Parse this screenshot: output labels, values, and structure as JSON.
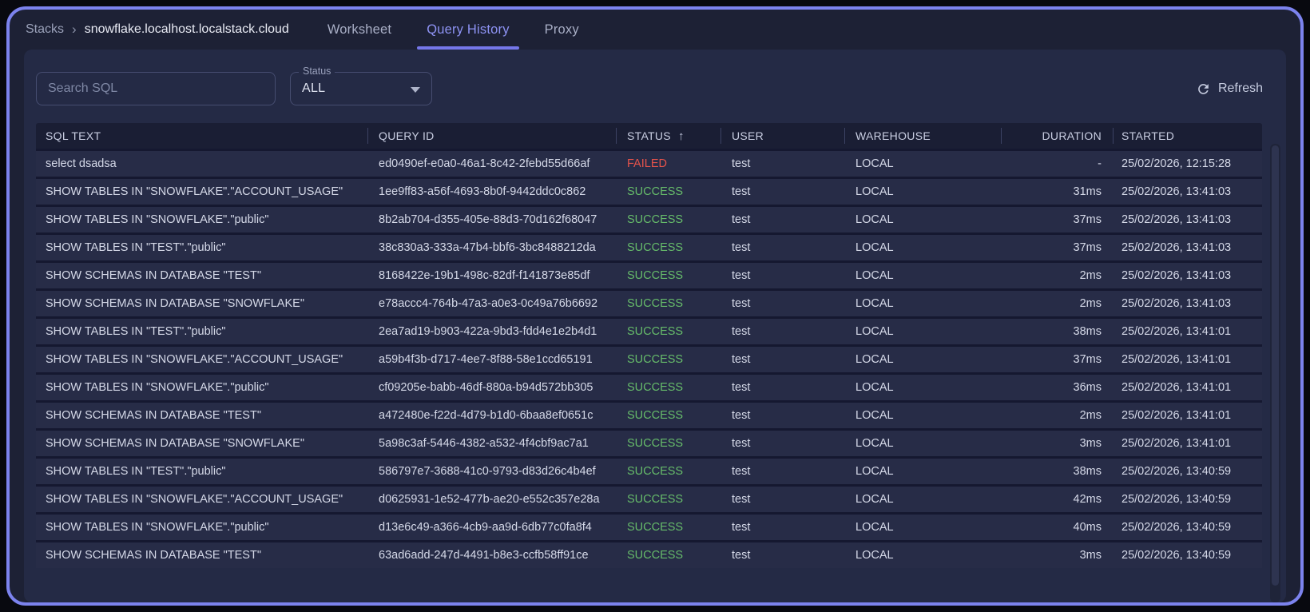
{
  "breadcrumb": {
    "root": "Stacks",
    "separator": "›",
    "current": "snowflake.localhost.localstack.cloud"
  },
  "tabs": [
    {
      "label": "Worksheet",
      "active": false
    },
    {
      "label": "Query History",
      "active": true
    },
    {
      "label": "Proxy",
      "active": false
    }
  ],
  "controls": {
    "search_placeholder": "Search SQL",
    "search_value": "",
    "status_filter": {
      "label": "Status",
      "value": "ALL"
    },
    "refresh_label": "Refresh"
  },
  "table": {
    "columns": [
      "SQL TEXT",
      "QUERY ID",
      "STATUS",
      "USER",
      "WAREHOUSE",
      "DURATION",
      "STARTED"
    ],
    "sorted_column": "STATUS",
    "sort_direction": "asc",
    "sort_arrow": "↑",
    "rows": [
      {
        "sql": "select dsadsa",
        "query_id": "ed0490ef-e0a0-46a1-8c42-2febd55d66af",
        "status": "FAILED",
        "user": "test",
        "warehouse": "LOCAL",
        "duration": "-",
        "started": "25/02/2026, 12:15:28"
      },
      {
        "sql": "SHOW TABLES IN \"SNOWFLAKE\".\"ACCOUNT_USAGE\"",
        "query_id": "1ee9ff83-a56f-4693-8b0f-9442ddc0c862",
        "status": "SUCCESS",
        "user": "test",
        "warehouse": "LOCAL",
        "duration": "31ms",
        "started": "25/02/2026, 13:41:03"
      },
      {
        "sql": "SHOW TABLES IN \"SNOWFLAKE\".\"public\"",
        "query_id": "8b2ab704-d355-405e-88d3-70d162f68047",
        "status": "SUCCESS",
        "user": "test",
        "warehouse": "LOCAL",
        "duration": "37ms",
        "started": "25/02/2026, 13:41:03"
      },
      {
        "sql": "SHOW TABLES IN \"TEST\".\"public\"",
        "query_id": "38c830a3-333a-47b4-bbf6-3bc8488212da",
        "status": "SUCCESS",
        "user": "test",
        "warehouse": "LOCAL",
        "duration": "37ms",
        "started": "25/02/2026, 13:41:03"
      },
      {
        "sql": "SHOW SCHEMAS IN DATABASE \"TEST\"",
        "query_id": "8168422e-19b1-498c-82df-f141873e85df",
        "status": "SUCCESS",
        "user": "test",
        "warehouse": "LOCAL",
        "duration": "2ms",
        "started": "25/02/2026, 13:41:03"
      },
      {
        "sql": "SHOW SCHEMAS IN DATABASE \"SNOWFLAKE\"",
        "query_id": "e78accc4-764b-47a3-a0e3-0c49a76b6692",
        "status": "SUCCESS",
        "user": "test",
        "warehouse": "LOCAL",
        "duration": "2ms",
        "started": "25/02/2026, 13:41:03"
      },
      {
        "sql": "SHOW TABLES IN \"TEST\".\"public\"",
        "query_id": "2ea7ad19-b903-422a-9bd3-fdd4e1e2b4d1",
        "status": "SUCCESS",
        "user": "test",
        "warehouse": "LOCAL",
        "duration": "38ms",
        "started": "25/02/2026, 13:41:01"
      },
      {
        "sql": "SHOW TABLES IN \"SNOWFLAKE\".\"ACCOUNT_USAGE\"",
        "query_id": "a59b4f3b-d717-4ee7-8f88-58e1ccd65191",
        "status": "SUCCESS",
        "user": "test",
        "warehouse": "LOCAL",
        "duration": "37ms",
        "started": "25/02/2026, 13:41:01"
      },
      {
        "sql": "SHOW TABLES IN \"SNOWFLAKE\".\"public\"",
        "query_id": "cf09205e-babb-46df-880a-b94d572bb305",
        "status": "SUCCESS",
        "user": "test",
        "warehouse": "LOCAL",
        "duration": "36ms",
        "started": "25/02/2026, 13:41:01"
      },
      {
        "sql": "SHOW SCHEMAS IN DATABASE \"TEST\"",
        "query_id": "a472480e-f22d-4d79-b1d0-6baa8ef0651c",
        "status": "SUCCESS",
        "user": "test",
        "warehouse": "LOCAL",
        "duration": "2ms",
        "started": "25/02/2026, 13:41:01"
      },
      {
        "sql": "SHOW SCHEMAS IN DATABASE \"SNOWFLAKE\"",
        "query_id": "5a98c3af-5446-4382-a532-4f4cbf9ac7a1",
        "status": "SUCCESS",
        "user": "test",
        "warehouse": "LOCAL",
        "duration": "3ms",
        "started": "25/02/2026, 13:41:01"
      },
      {
        "sql": "SHOW TABLES IN \"TEST\".\"public\"",
        "query_id": "586797e7-3688-41c0-9793-d83d26c4b4ef",
        "status": "SUCCESS",
        "user": "test",
        "warehouse": "LOCAL",
        "duration": "38ms",
        "started": "25/02/2026, 13:40:59"
      },
      {
        "sql": "SHOW TABLES IN \"SNOWFLAKE\".\"ACCOUNT_USAGE\"",
        "query_id": "d0625931-1e52-477b-ae20-e552c357e28a",
        "status": "SUCCESS",
        "user": "test",
        "warehouse": "LOCAL",
        "duration": "42ms",
        "started": "25/02/2026, 13:40:59"
      },
      {
        "sql": "SHOW TABLES IN \"SNOWFLAKE\".\"public\"",
        "query_id": "d13e6c49-a366-4cb9-aa9d-6db77c0fa8f4",
        "status": "SUCCESS",
        "user": "test",
        "warehouse": "LOCAL",
        "duration": "40ms",
        "started": "25/02/2026, 13:40:59"
      },
      {
        "sql": "SHOW SCHEMAS IN DATABASE \"TEST\"",
        "query_id": "63ad6add-247d-4491-b8e3-ccfb58ff91ce",
        "status": "SUCCESS",
        "user": "test",
        "warehouse": "LOCAL",
        "duration": "3ms",
        "started": "25/02/2026, 13:40:59"
      }
    ]
  },
  "colors": {
    "accent": "#7577e9",
    "frame_border": "#7c83ee",
    "success": "#66bb6a",
    "failed": "#e5534b"
  }
}
